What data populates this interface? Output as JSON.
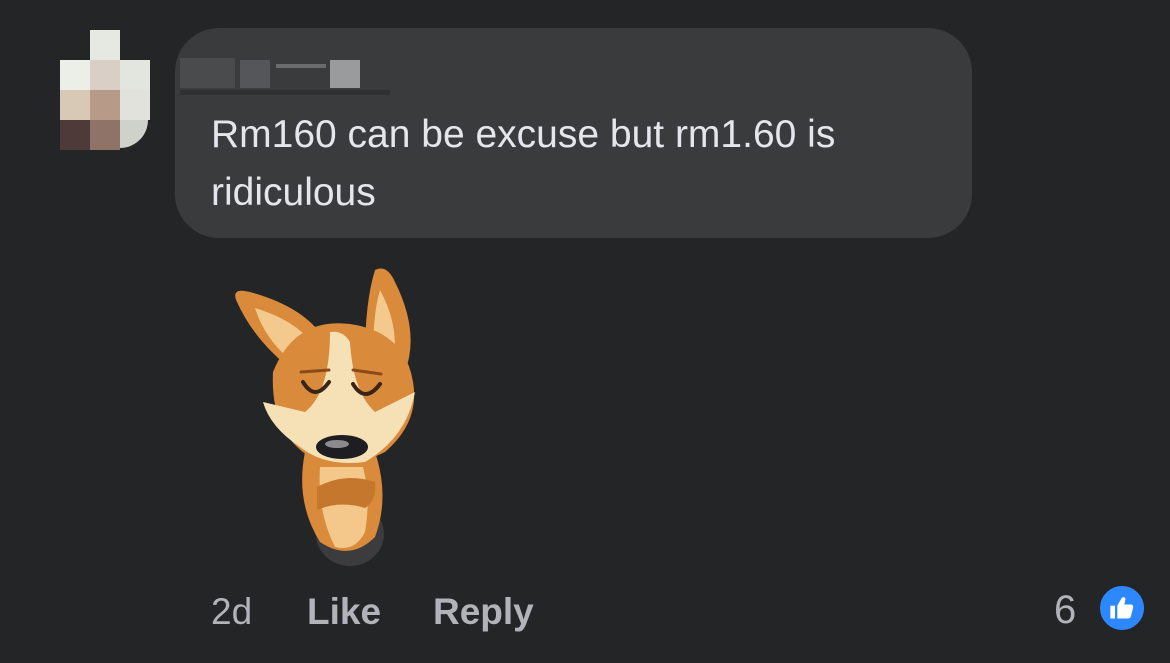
{
  "comment": {
    "text": "Rm160 can be excuse but rm1.60 is ridiculous",
    "time": "2d",
    "like_label": "Like",
    "reply_label": "Reply",
    "reaction_count": "6"
  },
  "icons": {
    "avatar": "pixelated-avatar",
    "sticker": "corgi-sticker-icon",
    "reaction": "thumbs-up-icon"
  },
  "colors": {
    "background": "#242526",
    "bubble": "#3a3b3c",
    "text": "#e4e6eb",
    "secondary": "#b0b3b8",
    "like_blue": "#2d88ff"
  }
}
